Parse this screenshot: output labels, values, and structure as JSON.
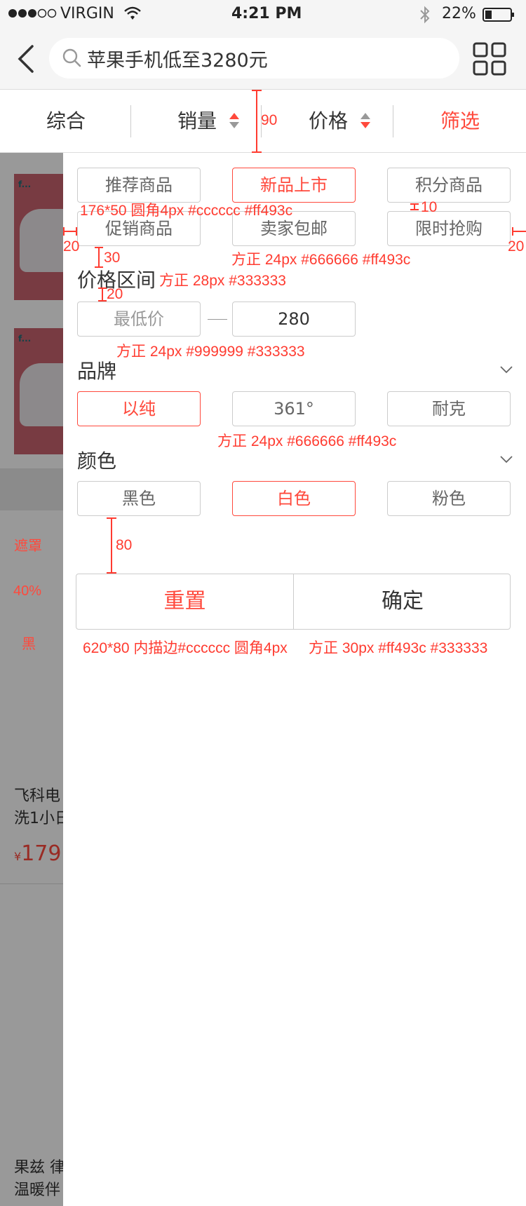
{
  "status_bar": {
    "carrier": "VIRGIN",
    "time": "4:21 PM",
    "battery": "22%",
    "signal_icon": "signal-dots-icon",
    "wifi_icon": "wifi-icon",
    "bluetooth_icon": "bluetooth-icon",
    "battery_icon": "battery-icon"
  },
  "header": {
    "back_icon": "chevron-left-icon",
    "search_icon": "search-icon",
    "search_value": "苹果手机低至3280元",
    "grid_icon": "grid-view-icon"
  },
  "sort_bar": {
    "items": [
      {
        "label": "综合"
      },
      {
        "label": "销量"
      },
      {
        "label": "价格"
      },
      {
        "label": "筛选"
      }
    ],
    "active_color": "#ff493c"
  },
  "background_list": {
    "image_tag": "f...",
    "product_1_title_line1": "飞科电",
    "product_1_title_line2": "洗1小日",
    "currency": "¥",
    "product_1_price": "179",
    "product_2_title_line1": "果兹 律",
    "product_2_title_line2": "温暖伴"
  },
  "mask_notes": {
    "line1": "遮罩",
    "line2": "40%",
    "line3": "黑"
  },
  "filter": {
    "tags": [
      {
        "label": "推荐商品",
        "active": false
      },
      {
        "label": "新品上市",
        "active": true
      },
      {
        "label": "积分商品",
        "active": false
      },
      {
        "label": "促销商品",
        "active": false
      },
      {
        "label": "卖家包邮",
        "active": false
      },
      {
        "label": "限时抢购",
        "active": false
      }
    ],
    "price_section": {
      "title": "价格区间",
      "min_placeholder": "最低价",
      "max_value": "280"
    },
    "brand_section": {
      "title": "品牌",
      "chevron_icon": "chevron-down-icon",
      "options": [
        {
          "label": "以纯",
          "active": true
        },
        {
          "label": "361°",
          "active": false
        },
        {
          "label": "耐克",
          "active": false
        }
      ]
    },
    "color_section": {
      "title": "颜色",
      "chevron_icon": "chevron-down-icon",
      "options": [
        {
          "label": "黑色",
          "active": false
        },
        {
          "label": "白色",
          "active": true
        },
        {
          "label": "粉色",
          "active": false
        }
      ]
    },
    "actions": {
      "reset": "重置",
      "confirm": "确定"
    }
  },
  "annotations": {
    "sortbar_height": "90",
    "tag_spec": "176*50 圆角4px #cccccc #ff493c",
    "row_gap": "10",
    "left_margin": "20",
    "right_margin": "20",
    "section_gap": "30",
    "tag_font": "方正 24px #666666 #ff493c",
    "title_font": "方正 28px #333333",
    "title_gap": "20",
    "price_font": "方正 24px #999999 #333333",
    "brand_font": "方正 24px #666666 #ff493c",
    "action_gap": "80",
    "action_spec_1": "620*80 内描边#cccccc 圆角4px",
    "action_spec_2": "方正 30px #ff493c #333333"
  }
}
